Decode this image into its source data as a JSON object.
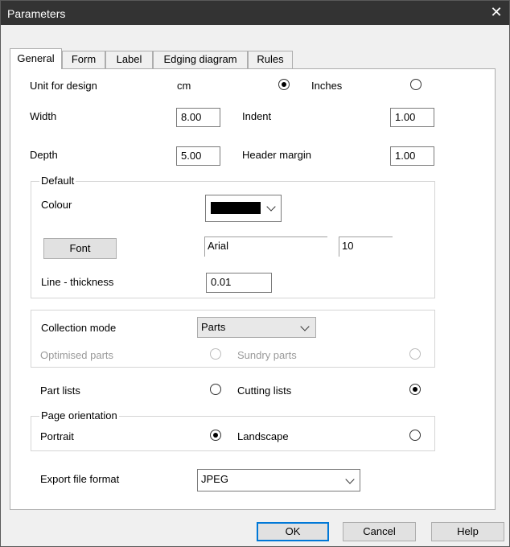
{
  "window": {
    "title": "Parameters",
    "close_glyph": "✕"
  },
  "tabs": [
    "General",
    "Form",
    "Label",
    "Edging diagram",
    "Rules"
  ],
  "unit": {
    "label": "Unit for design",
    "opt1": "cm",
    "opt2": "Inches",
    "selected": "cm"
  },
  "width": {
    "label": "Width",
    "value": "8.00"
  },
  "indent": {
    "label": "Indent",
    "value": "1.00"
  },
  "depth": {
    "label": "Depth",
    "value": "5.00"
  },
  "header_margin": {
    "label": "Header margin",
    "value": "1.00"
  },
  "default_group": {
    "legend": "Default",
    "colour_label": "Colour",
    "colour_value": "#000000",
    "font_button": "Font",
    "font_name": "Arial",
    "font_size": "10",
    "line_thickness_label": "Line - thickness",
    "line_thickness_value": "0.01"
  },
  "collection": {
    "label": "Collection mode",
    "value": "Parts",
    "opt_optimised": "Optimised parts",
    "opt_sundry": "Sundry parts"
  },
  "lists": {
    "opt1": "Part lists",
    "opt2": "Cutting lists",
    "selected": "Cutting lists"
  },
  "orientation": {
    "legend": "Page orientation",
    "opt1": "Portrait",
    "opt2": "Landscape",
    "selected": "Portrait"
  },
  "export": {
    "label": "Export file format",
    "value": "JPEG"
  },
  "buttons": {
    "ok": "OK",
    "cancel": "Cancel",
    "help": "Help"
  }
}
